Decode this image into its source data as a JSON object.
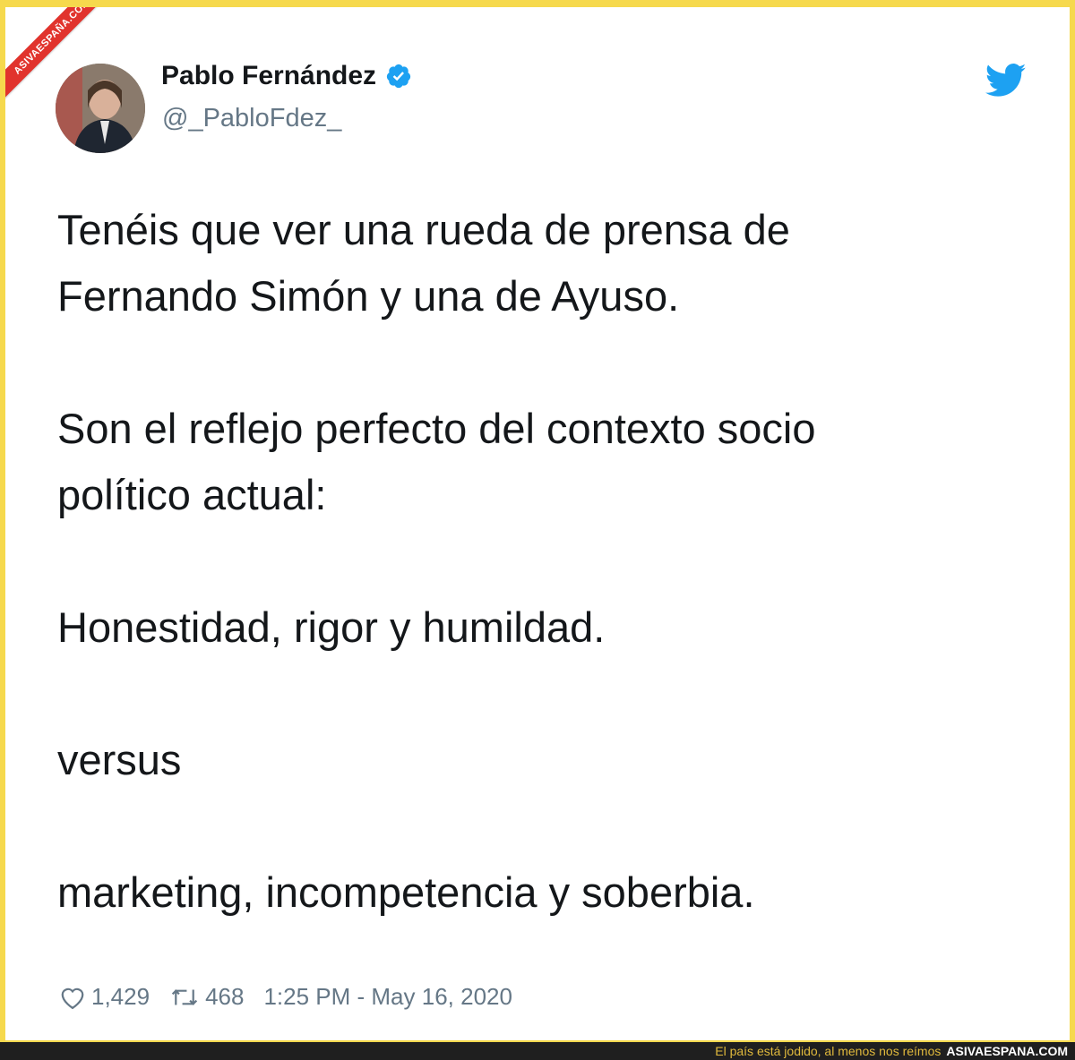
{
  "watermark": {
    "ribbon_text": "ASIVAESPAÑA.COM"
  },
  "tweet": {
    "author": {
      "display_name": "Pablo Fernández",
      "handle": "@_PabloFdez_",
      "verified": true
    },
    "text": "Tenéis que ver una rueda de prensa de\nFernando Simón y una de Ayuso.\n\nSon el reflejo perfecto del contexto socio\npolítico actual:\n\nHonestidad, rigor y humildad.\n\nversus\n\nmarketing, incompetencia y soberbia.",
    "likes": "1,429",
    "retweets": "468",
    "timestamp": "1:25 PM - May 16, 2020"
  },
  "footer": {
    "caption": "El país está jodido, al menos nos reímos",
    "brand": "ASIVAESPANA.COM"
  },
  "colors": {
    "background": "#f6d94d",
    "verified": "#1da1f2",
    "twitter_blue": "#1da1f2",
    "ribbon": "#e1332d"
  },
  "icons": [
    "verified-badge-icon",
    "twitter-bird-icon",
    "heart-icon",
    "retweet-icon"
  ]
}
